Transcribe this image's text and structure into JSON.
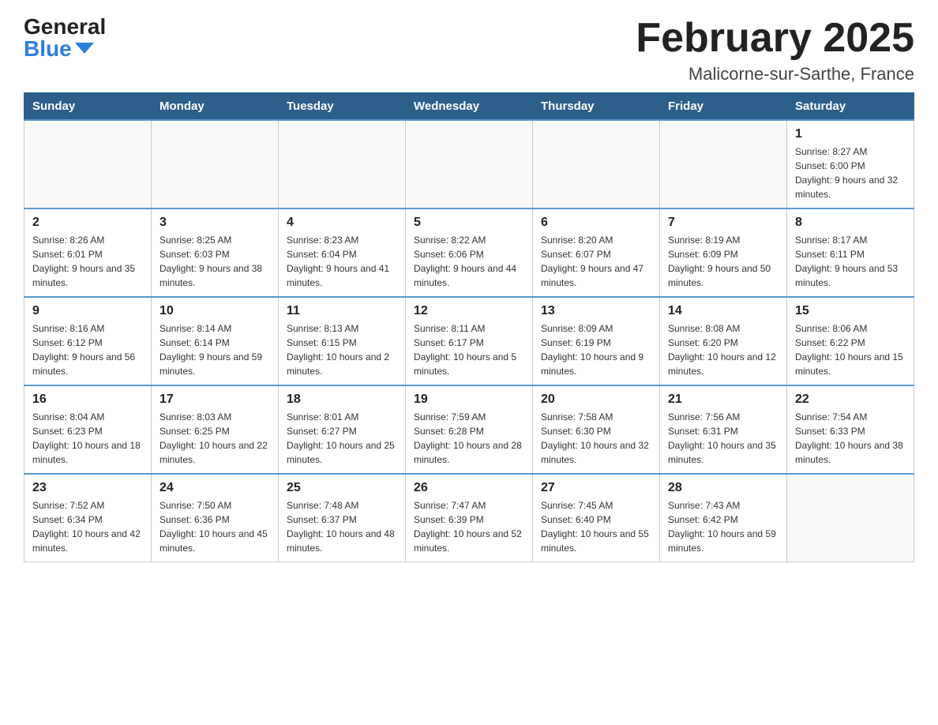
{
  "header": {
    "logo": {
      "general": "General",
      "blue": "Blue"
    },
    "title": "February 2025",
    "location": "Malicorne-sur-Sarthe, France"
  },
  "days_of_week": [
    "Sunday",
    "Monday",
    "Tuesday",
    "Wednesday",
    "Thursday",
    "Friday",
    "Saturday"
  ],
  "weeks": [
    [
      {
        "day": "",
        "info": ""
      },
      {
        "day": "",
        "info": ""
      },
      {
        "day": "",
        "info": ""
      },
      {
        "day": "",
        "info": ""
      },
      {
        "day": "",
        "info": ""
      },
      {
        "day": "",
        "info": ""
      },
      {
        "day": "1",
        "info": "Sunrise: 8:27 AM\nSunset: 6:00 PM\nDaylight: 9 hours and 32 minutes."
      }
    ],
    [
      {
        "day": "2",
        "info": "Sunrise: 8:26 AM\nSunset: 6:01 PM\nDaylight: 9 hours and 35 minutes."
      },
      {
        "day": "3",
        "info": "Sunrise: 8:25 AM\nSunset: 6:03 PM\nDaylight: 9 hours and 38 minutes."
      },
      {
        "day": "4",
        "info": "Sunrise: 8:23 AM\nSunset: 6:04 PM\nDaylight: 9 hours and 41 minutes."
      },
      {
        "day": "5",
        "info": "Sunrise: 8:22 AM\nSunset: 6:06 PM\nDaylight: 9 hours and 44 minutes."
      },
      {
        "day": "6",
        "info": "Sunrise: 8:20 AM\nSunset: 6:07 PM\nDaylight: 9 hours and 47 minutes."
      },
      {
        "day": "7",
        "info": "Sunrise: 8:19 AM\nSunset: 6:09 PM\nDaylight: 9 hours and 50 minutes."
      },
      {
        "day": "8",
        "info": "Sunrise: 8:17 AM\nSunset: 6:11 PM\nDaylight: 9 hours and 53 minutes."
      }
    ],
    [
      {
        "day": "9",
        "info": "Sunrise: 8:16 AM\nSunset: 6:12 PM\nDaylight: 9 hours and 56 minutes."
      },
      {
        "day": "10",
        "info": "Sunrise: 8:14 AM\nSunset: 6:14 PM\nDaylight: 9 hours and 59 minutes."
      },
      {
        "day": "11",
        "info": "Sunrise: 8:13 AM\nSunset: 6:15 PM\nDaylight: 10 hours and 2 minutes."
      },
      {
        "day": "12",
        "info": "Sunrise: 8:11 AM\nSunset: 6:17 PM\nDaylight: 10 hours and 5 minutes."
      },
      {
        "day": "13",
        "info": "Sunrise: 8:09 AM\nSunset: 6:19 PM\nDaylight: 10 hours and 9 minutes."
      },
      {
        "day": "14",
        "info": "Sunrise: 8:08 AM\nSunset: 6:20 PM\nDaylight: 10 hours and 12 minutes."
      },
      {
        "day": "15",
        "info": "Sunrise: 8:06 AM\nSunset: 6:22 PM\nDaylight: 10 hours and 15 minutes."
      }
    ],
    [
      {
        "day": "16",
        "info": "Sunrise: 8:04 AM\nSunset: 6:23 PM\nDaylight: 10 hours and 18 minutes."
      },
      {
        "day": "17",
        "info": "Sunrise: 8:03 AM\nSunset: 6:25 PM\nDaylight: 10 hours and 22 minutes."
      },
      {
        "day": "18",
        "info": "Sunrise: 8:01 AM\nSunset: 6:27 PM\nDaylight: 10 hours and 25 minutes."
      },
      {
        "day": "19",
        "info": "Sunrise: 7:59 AM\nSunset: 6:28 PM\nDaylight: 10 hours and 28 minutes."
      },
      {
        "day": "20",
        "info": "Sunrise: 7:58 AM\nSunset: 6:30 PM\nDaylight: 10 hours and 32 minutes."
      },
      {
        "day": "21",
        "info": "Sunrise: 7:56 AM\nSunset: 6:31 PM\nDaylight: 10 hours and 35 minutes."
      },
      {
        "day": "22",
        "info": "Sunrise: 7:54 AM\nSunset: 6:33 PM\nDaylight: 10 hours and 38 minutes."
      }
    ],
    [
      {
        "day": "23",
        "info": "Sunrise: 7:52 AM\nSunset: 6:34 PM\nDaylight: 10 hours and 42 minutes."
      },
      {
        "day": "24",
        "info": "Sunrise: 7:50 AM\nSunset: 6:36 PM\nDaylight: 10 hours and 45 minutes."
      },
      {
        "day": "25",
        "info": "Sunrise: 7:48 AM\nSunset: 6:37 PM\nDaylight: 10 hours and 48 minutes."
      },
      {
        "day": "26",
        "info": "Sunrise: 7:47 AM\nSunset: 6:39 PM\nDaylight: 10 hours and 52 minutes."
      },
      {
        "day": "27",
        "info": "Sunrise: 7:45 AM\nSunset: 6:40 PM\nDaylight: 10 hours and 55 minutes."
      },
      {
        "day": "28",
        "info": "Sunrise: 7:43 AM\nSunset: 6:42 PM\nDaylight: 10 hours and 59 minutes."
      },
      {
        "day": "",
        "info": ""
      }
    ]
  ]
}
